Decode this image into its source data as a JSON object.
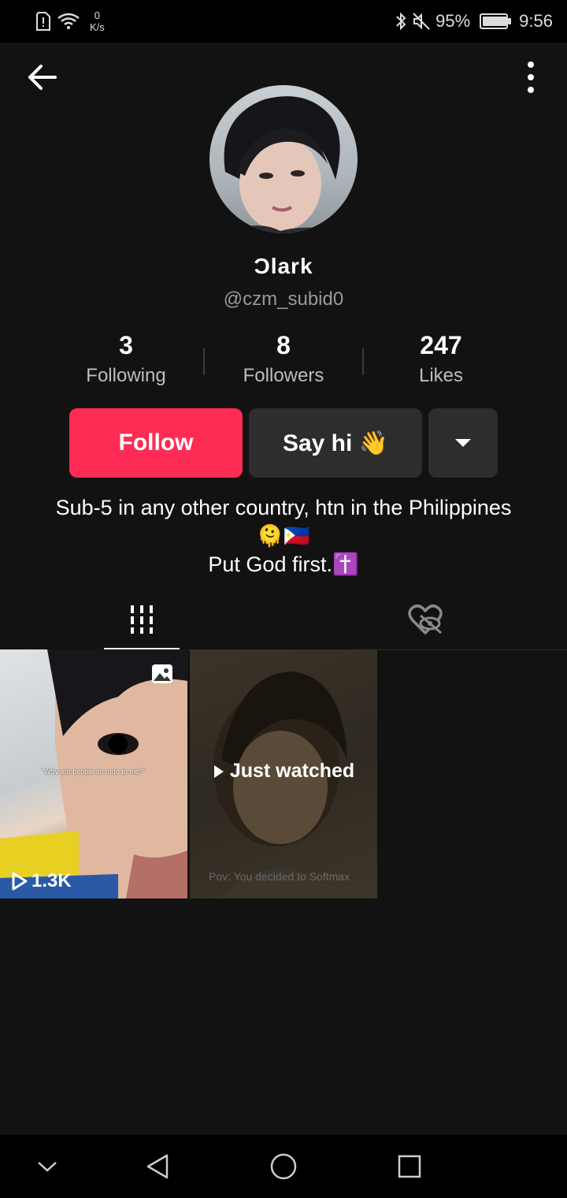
{
  "status_bar": {
    "net_speed_value": "0",
    "net_speed_unit": "K/s",
    "battery": "95%",
    "time": "9:56",
    "icons": [
      "sim-alert-icon",
      "wifi-icon",
      "bluetooth-icon",
      "mute-icon",
      "battery-icon"
    ]
  },
  "profile": {
    "display_name": "Ɔlark",
    "handle": "@czm_subid0",
    "stats": [
      {
        "value": "3",
        "label": "Following"
      },
      {
        "value": "8",
        "label": "Followers"
      },
      {
        "value": "247",
        "label": "Likes"
      }
    ],
    "follow_label": "Follow",
    "say_hi_label": "Say hi 👋",
    "bio_lines": [
      "Sub-5 in any other country, htn in the Philippines 🫠🇵🇭",
      "Put God first.✝️"
    ]
  },
  "tabs": [
    {
      "name": "videos",
      "icon": "grid-icon",
      "selected": true
    },
    {
      "name": "liked",
      "icon": "hidden-heart-icon",
      "selected": false
    }
  ],
  "videos": [
    {
      "caption": "\"Why are people so rude to me?\"",
      "views": "1.3K",
      "type": "photo"
    },
    {
      "overlay": "Just watched",
      "caption": "Pov: You decided to Softmax"
    }
  ],
  "colors": {
    "accent": "#fe2c55",
    "background": "#121212",
    "button_dark": "#2d2d2d"
  }
}
